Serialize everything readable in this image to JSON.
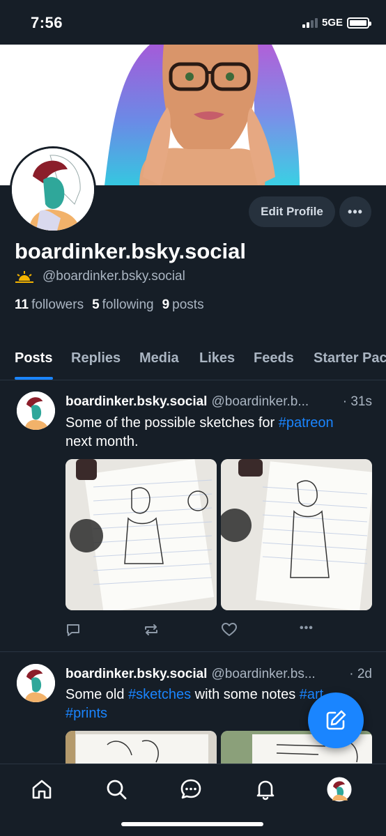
{
  "status_bar": {
    "time": "7:56",
    "network": "5GE"
  },
  "profile": {
    "display_name": "boardinker.bsky.social",
    "handle": "@boardinker.bsky.social",
    "edit_label": "Edit Profile",
    "more_label": "•••",
    "stats": {
      "followers_count": "11",
      "followers_label": "followers",
      "following_count": "5",
      "following_label": "following",
      "posts_count": "9",
      "posts_label": "posts"
    }
  },
  "tabs": [
    "Posts",
    "Replies",
    "Media",
    "Likes",
    "Feeds",
    "Starter Pac"
  ],
  "active_tab": "Posts",
  "posts": [
    {
      "author": "boardinker.bsky.social",
      "handle": "@boardinker.b...",
      "time": "· 31s",
      "text_pre": "Some of the possible sketches for ",
      "tag1": "#patreon",
      "text_post": "next month."
    },
    {
      "author": "boardinker.bsky.social",
      "handle": "@boardinker.bs...",
      "time": "· 2d",
      "text_pre": "Some old ",
      "tag1": "#sketches",
      "text_mid": " with some notes ",
      "tag2": "#art",
      "tag3": "#prints"
    }
  ],
  "actions": {
    "more_label": "•••"
  },
  "icons": {
    "reply": "reply-icon",
    "repost": "repost-icon",
    "like": "like-icon",
    "home": "home-icon",
    "search": "search-icon",
    "chat": "chat-icon",
    "notifications": "bell-icon",
    "compose": "compose-icon"
  },
  "colors": {
    "accent": "#1a85ff",
    "background": "#161e27",
    "muted": "#aab5c2"
  }
}
